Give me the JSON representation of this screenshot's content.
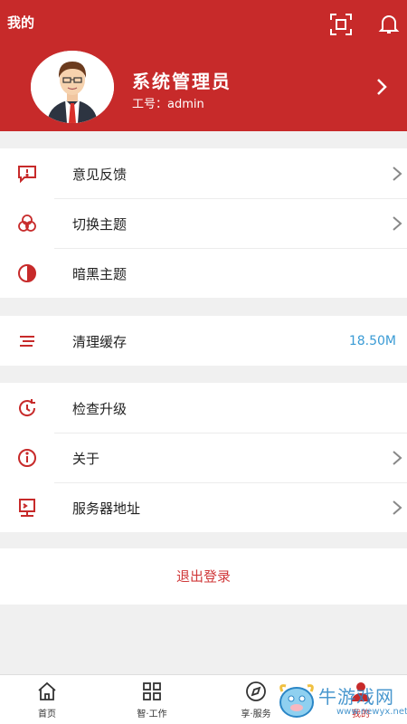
{
  "header": {
    "title": "我的",
    "user_name": "系统管理员",
    "user_id_label": "工号：admin"
  },
  "menu_group_1": [
    {
      "label": "意见反馈",
      "icon": "feedback-icon"
    },
    {
      "label": "切换主题",
      "icon": "theme-icon"
    },
    {
      "label": "暗黑主题",
      "icon": "dark-mode-icon"
    }
  ],
  "menu_group_2": [
    {
      "label": "清理缓存",
      "value": "18.50M",
      "icon": "clear-cache-icon"
    }
  ],
  "menu_group_3": [
    {
      "label": "检查升级",
      "icon": "update-icon"
    },
    {
      "label": "关于",
      "icon": "info-icon"
    },
    {
      "label": "服务器地址",
      "icon": "server-icon"
    }
  ],
  "logout_label": "退出登录",
  "tabs": [
    {
      "label": "首页",
      "icon": "home-icon"
    },
    {
      "label": "智·工作",
      "icon": "grid-icon"
    },
    {
      "label": "享·服务",
      "icon": "compass-icon"
    },
    {
      "label": "我的",
      "icon": "user-icon"
    }
  ],
  "watermark": {
    "text": "牛游戏网",
    "sub": "www.newyx.net"
  },
  "colors": {
    "primary": "#c72a2a",
    "accent_value": "#3a9bd5",
    "background": "#f0f0f0"
  }
}
